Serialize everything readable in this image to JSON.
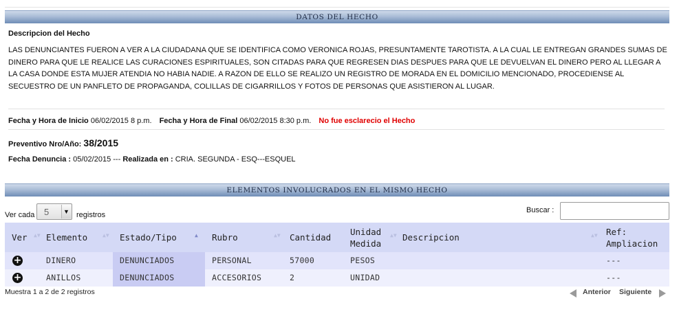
{
  "section_datos": {
    "title": "DATOS DEL HECHO"
  },
  "descripcion": {
    "title": "Descripcion del Hecho",
    "text": "LAS DENUNCIANTES FUERON A VER A LA CIUDADANA QUE SE IDENTIFICA COMO VERONICA ROJAS, PRESUNTAMENTE TAROTISTA. A LA CUAL LE ENTREGAN GRANDES SUMAS DE DINERO PARA QUE LE REALICE LAS CURACIONES ESPIRITUALES, SON CITADAS PARA QUE REGRESEN DIAS DESPUES PARA QUE LE DEVUELVAN EL DINERO PERO AL LLEGAR A LA CASA DONDE ESTA MUJER ATENDIA NO HABIA NADIE. A RAZON DE ELLO SE REALIZO UN REGISTRO DE MORADA EN EL DOMICILIO MENCIONADO, PROCEDIENSE AL SECUESTRO DE UN PANFLETO DE PROPAGANDA, COLILLAS DE CIGARRILLOS Y FOTOS DE PERSONAS QUE ASISTIERON AL LUGAR."
  },
  "fechas": {
    "inicio_label": "Fecha y Hora de Inicio",
    "inicio_value": "06/02/2015 8 p.m.",
    "final_label": "Fecha y Hora de Final",
    "final_value": "06/02/2015 8:30 p.m.",
    "status": "No fue esclarecio el Hecho"
  },
  "preventivo": {
    "label": "Preventivo Nro/Año:",
    "value": "38/2015"
  },
  "denuncia": {
    "fecha_label": "Fecha Denuncia :",
    "fecha_value": "05/02/2015 ---",
    "realizada_label": "Realizada en :",
    "realizada_value": "CRIA. SEGUNDA - ESQ---ESQUEL"
  },
  "section_elementos": {
    "title": "ELEMENTOS INVOLUCRADOS EN EL MISMO HECHO"
  },
  "controls": {
    "ver_cada": "Ver cada",
    "page_size": "5",
    "registros": "registros",
    "buscar_label": "Buscar :",
    "buscar_value": ""
  },
  "table": {
    "columns": {
      "ver": "Ver",
      "elemento": "Elemento",
      "estado": "Estado/Tipo",
      "rubro": "Rubro",
      "cantidad": "Cantidad",
      "unidad_1": "Unidad",
      "unidad_2": "Medida",
      "descripcion": "Descripcion",
      "ref_1": "Ref:",
      "ref_2": "Ampliacion"
    },
    "rows": [
      {
        "elemento": "DINERO",
        "estado": "DENUNCIADOS",
        "rubro": "PERSONAL",
        "cantidad": "57000",
        "unidad": "PESOS",
        "descripcion": "",
        "ref": "---"
      },
      {
        "elemento": "ANILLOS",
        "estado": "DENUNCIADOS",
        "rubro": "ACCESORIOS",
        "cantidad": "2",
        "unidad": "UNIDAD",
        "descripcion": "",
        "ref": "---"
      }
    ]
  },
  "footer": {
    "info": "Muestra 1 a 2 de 2 registros",
    "prev": "Anterior",
    "next": "Siguiente"
  },
  "icons": {
    "expand": "plus-circle-icon",
    "sort": "sort-arrows-icon",
    "prev": "triangle-left-icon",
    "next": "triangle-right-icon"
  }
}
